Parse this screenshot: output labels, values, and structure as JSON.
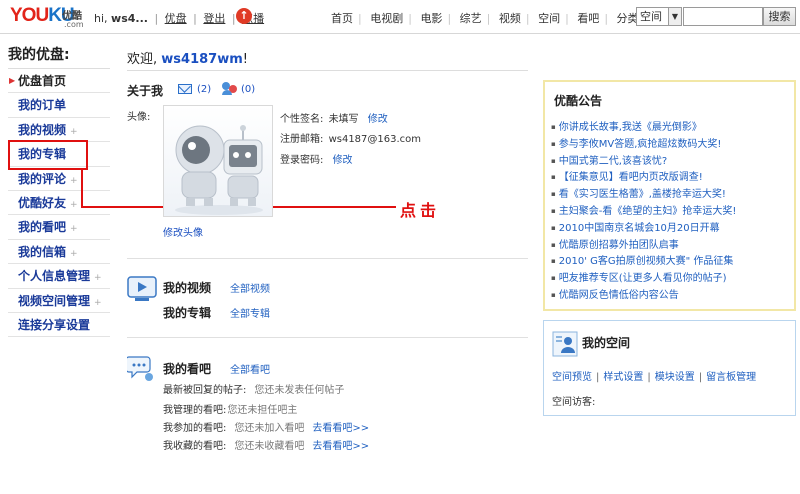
{
  "header": {
    "logo": {
      "text_part1": "YOU",
      "text_part2": "KU",
      "cn": "优酷",
      "com": ".com"
    },
    "user": {
      "greeting": "hi,",
      "username": "ws4...",
      "links": [
        "优盘",
        "登出",
        "点播"
      ]
    },
    "nav": [
      "首页",
      "电视剧",
      "电影",
      "综艺",
      "视频",
      "空间",
      "看吧"
    ],
    "nav_dropdown": "分类",
    "search": {
      "scope": "空间",
      "scope_arrow": "▼",
      "button": "搜索",
      "query": ""
    }
  },
  "sidebar": {
    "title": "我的优盘:",
    "items": [
      {
        "label": "优盘首页",
        "active": true,
        "plus": false
      },
      {
        "label": "我的订单",
        "plus": false
      },
      {
        "label": "我的视频",
        "plus": true
      },
      {
        "label": "我的专辑",
        "plus": false
      },
      {
        "label": "我的评论",
        "plus": true
      },
      {
        "label": "优酷好友",
        "plus": true
      },
      {
        "label": "我的看吧",
        "plus": true
      },
      {
        "label": "我的信箱",
        "plus": true
      },
      {
        "label": "个人信息管理",
        "plus": true
      },
      {
        "label": "视频空间管理",
        "plus": true
      },
      {
        "label": "连接分享设置",
        "plus": false
      }
    ],
    "plus_mark": "+"
  },
  "annotation": {
    "text": "点击",
    "color": "#e01010"
  },
  "main": {
    "welcome_prefix": "欢迎,",
    "welcome_name": "ws4187wm",
    "welcome_suffix": "!",
    "about": {
      "title": "关于我",
      "mail_count": "(2)",
      "friends_count": "(0)",
      "avatar_label": "头像:",
      "edit_avatar": "修改头像",
      "signature_label": "个性签名:",
      "signature_value": "未填写",
      "signature_edit": "修改",
      "email_label": "注册邮箱:",
      "email_value": "ws4187@163.com",
      "password_label": "登录密码:",
      "password_edit": "修改"
    },
    "videos": {
      "title": "我的视频",
      "all_link": "全部视频",
      "album_title": "我的专辑",
      "all_album_link": "全部专辑"
    },
    "bars": {
      "title": "我的看吧",
      "all_link": "全部看吧",
      "rows": [
        {
          "label": "最新被回复的帖子:",
          "text": "您还未发表任何帖子",
          "link": ""
        },
        {
          "label": "我管理的看吧:",
          "text": "您还未担任吧主",
          "link": ""
        },
        {
          "label": "我参加的看吧:",
          "text": "您还未加入看吧",
          "link": "去看看吧>>"
        },
        {
          "label": "我收藏的看吧:",
          "text": "您还未收藏看吧",
          "link": "去看看吧>>"
        }
      ]
    }
  },
  "notice": {
    "title": "优酷公告",
    "items": [
      "你讲成长故事,我送《晨光倒影》",
      "参与李攸MV答题,疯抢超炫数码大奖!",
      "中国式第二代,该喜该忧?",
      "【征集意见】看吧内页改版调查!",
      "看《实习医生格蕾》,盖楼抢幸运大奖!",
      "主妇聚会-看《绝望的主妇》抢幸运大奖!",
      "2010中国南京名城会10月20日开幕",
      "优酷原创招募外拍团队启事",
      "2010' G客G拍原创视频大赛\" 作品征集",
      "吧友推荐专区(让更多人看见你的帖子)",
      "优酷网反色情低俗内容公告"
    ]
  },
  "space": {
    "title": "我的空间",
    "links": [
      "空间预览",
      "样式设置",
      "模块设置",
      "留言板管理"
    ],
    "visitors_label": "空间访客:"
  }
}
